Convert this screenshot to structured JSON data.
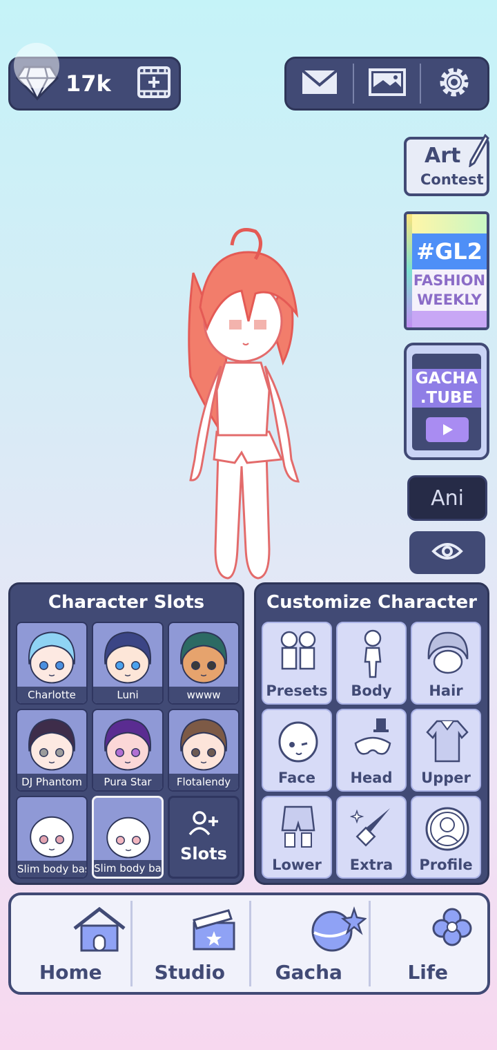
{
  "top_bar": {
    "gem_count": "17k"
  },
  "side": {
    "art_contest_line1": "Art",
    "art_contest_line2": "Contest",
    "gl2_title": "#GL2",
    "gl2_line1": "FASHION",
    "gl2_line2": "WEEKLY",
    "gacha_tube_line1": "GACHA",
    "gacha_tube_line2": ".TUBE",
    "ani_label": "Ani"
  },
  "character_slots": {
    "title": "Character Slots",
    "slots": [
      {
        "name": "Charlotte",
        "hair": "#8fd3f4",
        "skin": "#fde9e2",
        "eyes": "#4a8fe0"
      },
      {
        "name": "Luni",
        "hair": "#3b4585",
        "skin": "#fde6d8",
        "eyes": "#4aa2ee"
      },
      {
        "name": "wwww",
        "hair": "#2c6a63",
        "skin": "#e6a36d",
        "eyes": "#3a3a3a"
      },
      {
        "name": "DJ Phantom",
        "hair": "#3e2d4a",
        "skin": "#fde9e2",
        "eyes": "#9c9c9c"
      },
      {
        "name": "Pura Star",
        "hair": "#5a2c91",
        "skin": "#fbd7d7",
        "eyes": "#b16fd3"
      },
      {
        "name": "Flotalendy",
        "hair": "#7d5a46",
        "skin": "#fde4da",
        "eyes": "#6d5a52"
      },
      {
        "name": "Slim body bas",
        "hair": "",
        "skin": "#ffffff",
        "eyes": "#e3a3b0"
      },
      {
        "name": "Slim body bas",
        "hair": "",
        "skin": "#ffffff",
        "eyes": "#f2b6bf"
      }
    ],
    "add_label": "Slots"
  },
  "customize": {
    "title": "Customize Character",
    "items": [
      {
        "label": "Presets",
        "icon": "presets-icon"
      },
      {
        "label": "Body",
        "icon": "body-icon"
      },
      {
        "label": "Hair",
        "icon": "hair-icon"
      },
      {
        "label": "Face",
        "icon": "face-icon"
      },
      {
        "label": "Head",
        "icon": "head-icon"
      },
      {
        "label": "Upper",
        "icon": "upper-icon"
      },
      {
        "label": "Lower",
        "icon": "lower-icon"
      },
      {
        "label": "Extra",
        "icon": "extra-icon"
      },
      {
        "label": "Profile",
        "icon": "profile-icon"
      }
    ]
  },
  "nav": {
    "items": [
      {
        "label": "Home",
        "icon": "home-icon"
      },
      {
        "label": "Studio",
        "icon": "studio-icon"
      },
      {
        "label": "Gacha",
        "icon": "gacha-icon"
      },
      {
        "label": "Life",
        "icon": "life-icon"
      }
    ]
  },
  "colors": {
    "panel_dark": "#414a75",
    "accent_purple": "#8f7ee6",
    "character_hair": "#f07a6a"
  }
}
